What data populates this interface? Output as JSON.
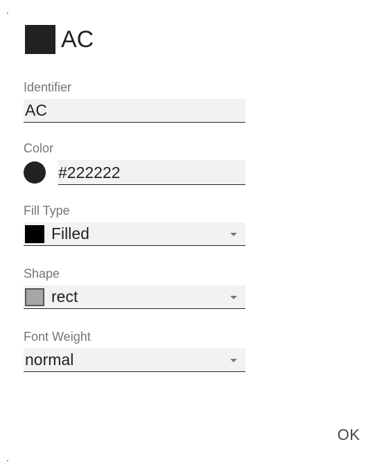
{
  "dialog": {
    "title": "AC",
    "title_color": "#222222",
    "ok_label": "OK"
  },
  "fields": {
    "identifier": {
      "label": "Identifier",
      "value": "AC"
    },
    "color": {
      "label": "Color",
      "value": "#222222",
      "swatch_color": "#222222"
    },
    "fill_type": {
      "label": "Fill Type",
      "value": "Filled",
      "swatch_color": "#000000",
      "icon": "filled-swatch-icon"
    },
    "shape": {
      "label": "Shape",
      "value": "rect",
      "swatch_color": "#a6a6a6",
      "icon": "rect-swatch-icon"
    },
    "font_weight": {
      "label": "Font Weight",
      "value": "normal"
    }
  },
  "colors": {
    "field_background": "#f2f2f2",
    "label": "#757575",
    "text": "#222222"
  }
}
